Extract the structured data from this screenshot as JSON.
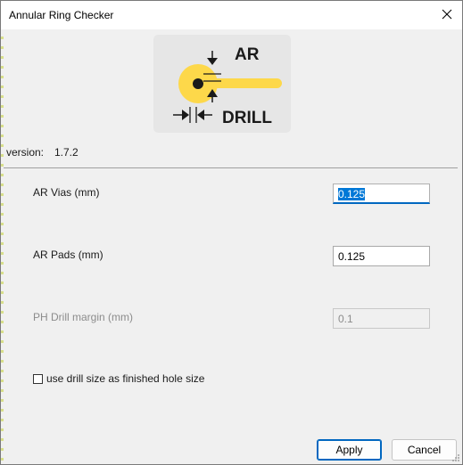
{
  "window": {
    "title": "Annular Ring Checker"
  },
  "logo": {
    "top_text": "AR",
    "bottom_text": "DRILL"
  },
  "version": {
    "label": "version:",
    "value": "1.7.2"
  },
  "fields": {
    "ar_vias": {
      "label": "AR Vias (mm)",
      "value": "0.125"
    },
    "ar_pads": {
      "label": "AR Pads (mm)",
      "value": "0.125"
    },
    "ph_drill_margin": {
      "label": "PH Drill margin (mm)",
      "value": "0.1"
    }
  },
  "checkbox": {
    "label": "use drill size as finished hole size",
    "checked": false
  },
  "buttons": {
    "apply": "Apply",
    "cancel": "Cancel"
  },
  "colors": {
    "accent": "#0067c0",
    "selection": "#0078d7",
    "logo_yellow": "#fdd84a",
    "logo_bg": "#e6e6e6"
  }
}
